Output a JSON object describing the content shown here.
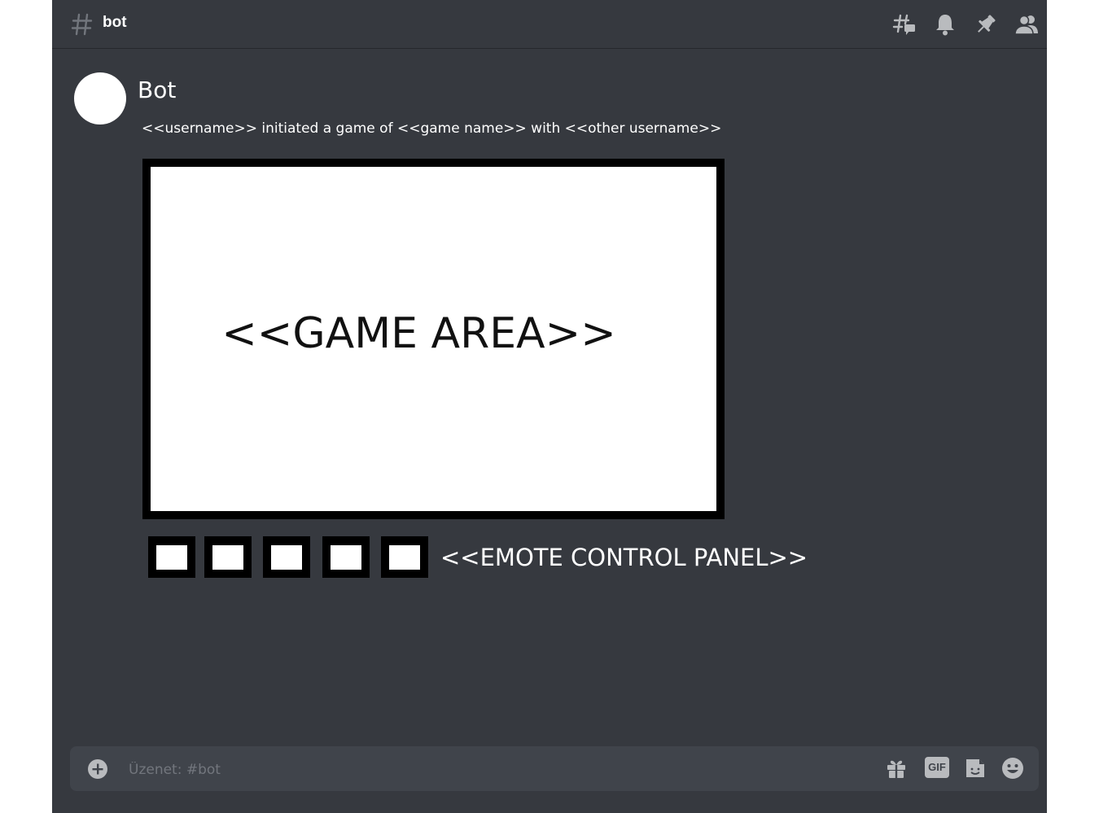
{
  "header": {
    "channel_name": "bot",
    "icons": [
      "threads-icon",
      "bell-icon",
      "pin-icon",
      "members-icon"
    ]
  },
  "message": {
    "author": "Bot",
    "text": "<<username>> initiated a game of <<game name>> with <<other username>>",
    "game_area_label": "<<GAME AREA>>",
    "emote_control_label": "<<EMOTE CONTROL PANEL>>",
    "emote_buttons": [
      "",
      "",
      "",
      "",
      ""
    ]
  },
  "composer": {
    "placeholder": "Üzenet: #bot",
    "gif_label": "GIF",
    "icons": [
      "add-icon",
      "gift-icon",
      "gif-icon",
      "sticker-icon",
      "emoji-icon"
    ]
  },
  "colors": {
    "background": "#36393f",
    "composer": "#40444b",
    "icon": "#b9bbbe",
    "text": "#ffffff"
  }
}
